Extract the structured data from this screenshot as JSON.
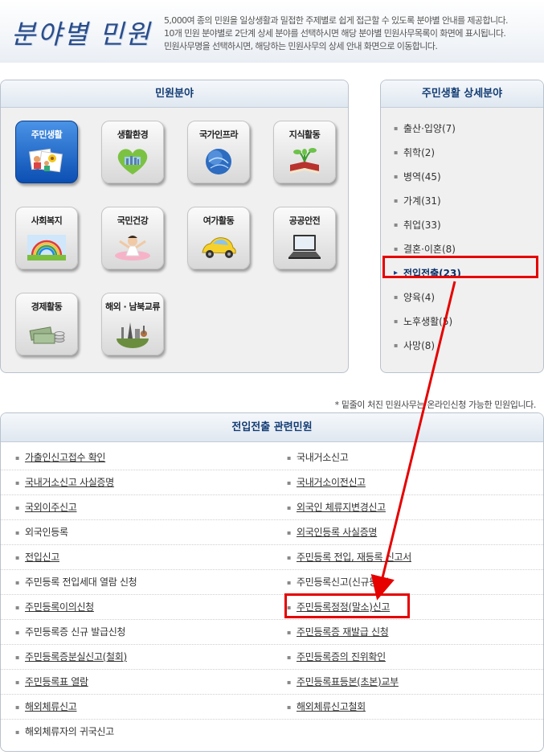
{
  "header": {
    "title": "분야별 민원",
    "desc": [
      "5,000여 종의 민원을 일상생활과 밀접한 주제별로 쉽게 접근할 수 있도록 분야별 안내를 제공합니다.",
      "10개 민원 분야별로 2단계 상세 분야를 선택하시면 해당 분야별 민원사무목록이 화면에 표시됩니다.",
      "민원사무명을 선택하시면, 해당하는 민원사무의 상세 안내 화면으로 이동합니다."
    ]
  },
  "categories": {
    "title": "민원분야",
    "items": [
      {
        "label": "주민생활",
        "icon": "family-photo-icon",
        "active": true
      },
      {
        "label": "생활환경",
        "icon": "heart-city-icon"
      },
      {
        "label": "국가인프라",
        "icon": "globe-icon"
      },
      {
        "label": "지식활동",
        "icon": "book-plant-icon"
      },
      {
        "label": "사회복지",
        "icon": "rainbow-icon"
      },
      {
        "label": "국민건강",
        "icon": "healthy-person-icon"
      },
      {
        "label": "여가활동",
        "icon": "yellow-car-icon"
      },
      {
        "label": "공공안전",
        "icon": "laptop-icon"
      },
      {
        "label": "경제활동",
        "icon": "money-coins-icon"
      },
      {
        "label": "해외 · 남북교류",
        "icon": "world-landmarks-icon"
      }
    ]
  },
  "subcategories": {
    "title": "주민생활 상세분야",
    "items": [
      {
        "label": "출산·입양(7)"
      },
      {
        "label": "취학(2)"
      },
      {
        "label": "병역(45)"
      },
      {
        "label": "가계(31)"
      },
      {
        "label": "취업(33)"
      },
      {
        "label": "결혼·이혼(8)"
      },
      {
        "label": "전입전출(23)",
        "selected": true
      },
      {
        "label": "양육(4)"
      },
      {
        "label": "노후생활(5)"
      },
      {
        "label": "사망(8)"
      }
    ]
  },
  "note": "* 밑줄이 처진 민원사무는 온라인신청 가능한 민원입니다.",
  "related": {
    "title": "전입전출 관련민원",
    "rows": [
      [
        {
          "label": "가출인신고접수 확인",
          "link": true
        },
        {
          "label": "국내거소신고",
          "link": false
        }
      ],
      [
        {
          "label": "국내거소신고 사실증명",
          "link": true
        },
        {
          "label": "국내거소이전신고",
          "link": true
        }
      ],
      [
        {
          "label": "국외이주신고",
          "link": true
        },
        {
          "label": "외국인 체류지변경신고",
          "link": true
        }
      ],
      [
        {
          "label": "외국인등록",
          "link": false
        },
        {
          "label": "외국인등록 사실증명",
          "link": true
        }
      ],
      [
        {
          "label": "전입신고",
          "link": true
        },
        {
          "label": "주민등록 전입, 재등록 신고서",
          "link": true
        }
      ],
      [
        {
          "label": "주민등록 전입세대 열람 신청",
          "link": false
        },
        {
          "label": "주민등록신고(신규등록)",
          "link": false
        }
      ],
      [
        {
          "label": "주민등록이의신청",
          "link": true
        },
        {
          "label": "주민등록정정(말소)신고",
          "link": true
        }
      ],
      [
        {
          "label": "주민등록증 신규 발급신청",
          "link": false
        },
        {
          "label": "주민등록증 재발급 신청",
          "link": true
        }
      ],
      [
        {
          "label": "주민등록증분실신고(철회)",
          "link": true
        },
        {
          "label": "주민등록증의 진위확인",
          "link": true
        }
      ],
      [
        {
          "label": "주민등록표 열람",
          "link": true
        },
        {
          "label": "주민등록표등본(초본)교부",
          "link": true
        }
      ],
      [
        {
          "label": "해외체류신고",
          "link": true
        },
        {
          "label": "해외체류신고철회",
          "link": true
        }
      ],
      [
        {
          "label": "해외체류자의 귀국신고",
          "link": false
        },
        null
      ]
    ]
  },
  "colors": {
    "highlight": "#e60000",
    "header_text": "#123c73",
    "active_tile": "#0b4fb3"
  }
}
